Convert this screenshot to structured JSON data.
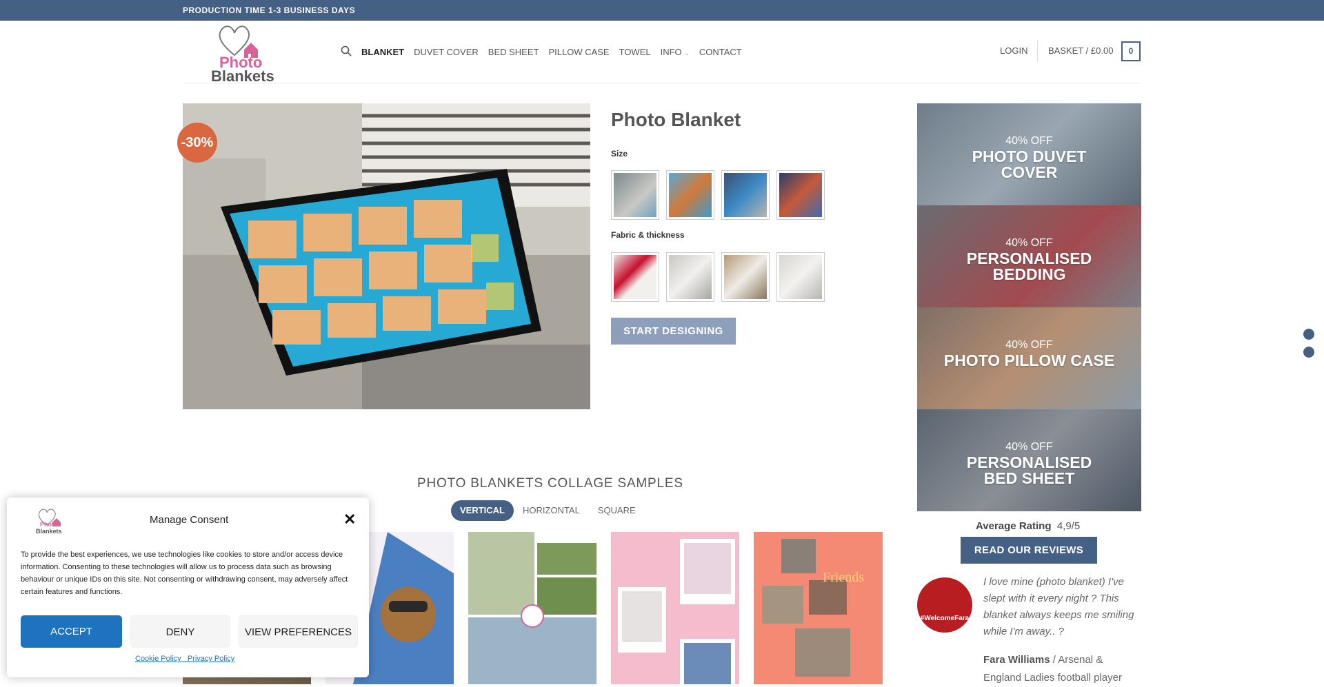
{
  "topbar": {
    "text": "PRODUCTION TIME 1-3 BUSINESS DAYS"
  },
  "logo": {
    "line1": "Photo",
    "line2": "Blankets"
  },
  "nav": {
    "items": [
      "BLANKET",
      "DUVET COVER",
      "BED SHEET",
      "PILLOW CASE",
      "TOWEL",
      "INFO",
      "CONTACT"
    ],
    "active": "BLANKET",
    "search_icon": "search-icon",
    "login": "LOGIN",
    "basket": "BASKET / £0.00",
    "basket_count": "0"
  },
  "product": {
    "title": "Photo Blanket",
    "sale_badge": "-30%",
    "size_label": "Size",
    "fabric_label": "Fabric & thickness",
    "start_button": "START DESIGNING"
  },
  "promos": [
    {
      "off": "40% OFF",
      "name": "PHOTO DUVET COVER"
    },
    {
      "off": "40% OFF",
      "name": "PERSONALISED BEDDING"
    },
    {
      "off": "40% OFF",
      "name": "PHOTO PILLOW CASE"
    },
    {
      "off": "40% OFF",
      "name": "PERSONALISED BED SHEET"
    }
  ],
  "rating": {
    "label": "Average Rating",
    "value": "4,9/5",
    "button": "READ OUR REVIEWS"
  },
  "testimonial": {
    "avatar_text": "#WelcomeFara",
    "quote": "I love mine (photo blanket) I've slept with it every night ? This blanket always keeps me smiling while I'm away.. ?",
    "author": "Fara Williams",
    "author_desc": " / Arsenal & England Ladies football player"
  },
  "samples": {
    "title": "PHOTO BLANKETS COLLAGE SAMPLES",
    "tabs": [
      "VERTICAL",
      "HORIZONTAL",
      "SQUARE"
    ],
    "active_tab": "VERTICAL",
    "friends_text": "Friends"
  },
  "consent": {
    "title": "Manage Consent",
    "logo_line1": "Photo",
    "logo_line2": "Blankets",
    "body": "To provide the best experiences, we use technologies like cookies to store and/or access device information. Consenting to these technologies will allow us to process data such as browsing behaviour or unique IDs on this site. Not consenting or withdrawing consent, may adversely affect certain features and functions.",
    "accept": "ACCEPT",
    "deny": "DENY",
    "preferences": "VIEW PREFERENCES",
    "cookie_policy": "Cookie Policy",
    "privacy_policy": "Privacy Policy"
  },
  "colors": {
    "brand": "#446084",
    "sale": "#d9673f",
    "accept": "#1e73be"
  }
}
